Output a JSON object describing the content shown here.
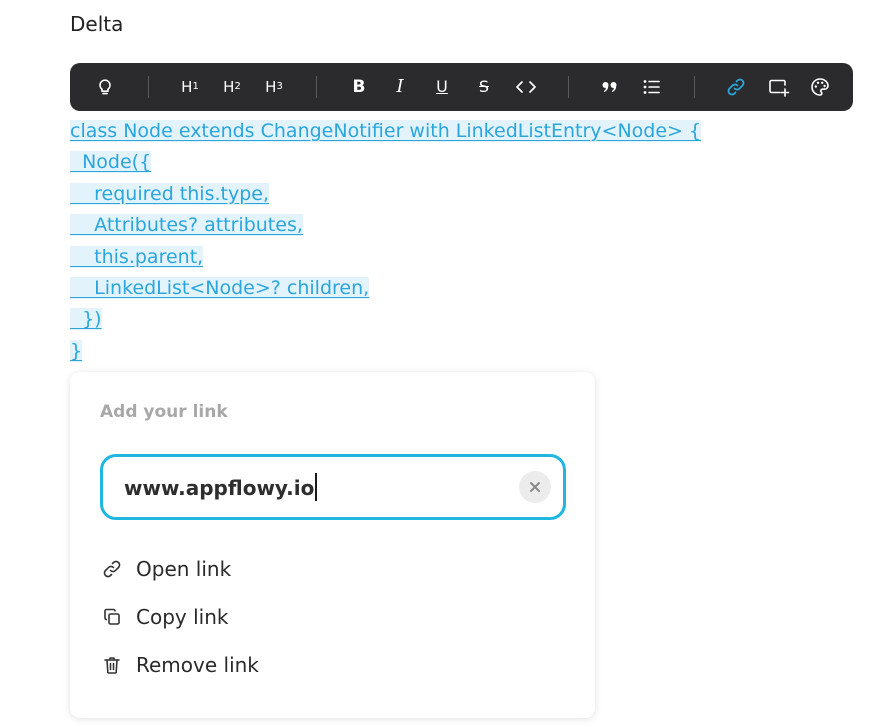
{
  "page": {
    "title": "Delta"
  },
  "toolbar": {
    "items": [
      {
        "name": "lightbulb-icon"
      },
      {
        "name": "heading-1",
        "label": "H",
        "sub": "1"
      },
      {
        "name": "heading-2",
        "label": "H",
        "sub": "2"
      },
      {
        "name": "heading-3",
        "label": "H",
        "sub": "3"
      },
      {
        "name": "bold",
        "label": "B"
      },
      {
        "name": "italic",
        "label": "I"
      },
      {
        "name": "underline",
        "label": "U"
      },
      {
        "name": "strikethrough",
        "label": "S"
      },
      {
        "name": "code-icon"
      },
      {
        "name": "quote-icon"
      },
      {
        "name": "bulleted-list-icon"
      },
      {
        "name": "link-icon"
      },
      {
        "name": "add-block-icon"
      },
      {
        "name": "palette-icon"
      }
    ],
    "active_color": "#2aa6dd",
    "background": "#2b2b2e"
  },
  "code": {
    "lines": [
      "class Node extends ChangeNotifier with LinkedListEntry<Node> {",
      "  Node({",
      "    required this.type,",
      "    Attributes? attributes,",
      "    this.parent,",
      "    LinkedList<Node>? children,",
      "  })",
      "}"
    ],
    "link_color": "#2aa6dd",
    "highlight_color": "#e3f3fb"
  },
  "link_popup": {
    "title": "Add your link",
    "input_value": "www.appflowy.io",
    "accent_color": "#1fb6e0",
    "actions": [
      {
        "name": "open-link",
        "icon": "link-icon",
        "label": "Open link"
      },
      {
        "name": "copy-link",
        "icon": "copy-icon",
        "label": "Copy link"
      },
      {
        "name": "remove-link",
        "icon": "trash-icon",
        "label": "Remove link"
      }
    ]
  }
}
